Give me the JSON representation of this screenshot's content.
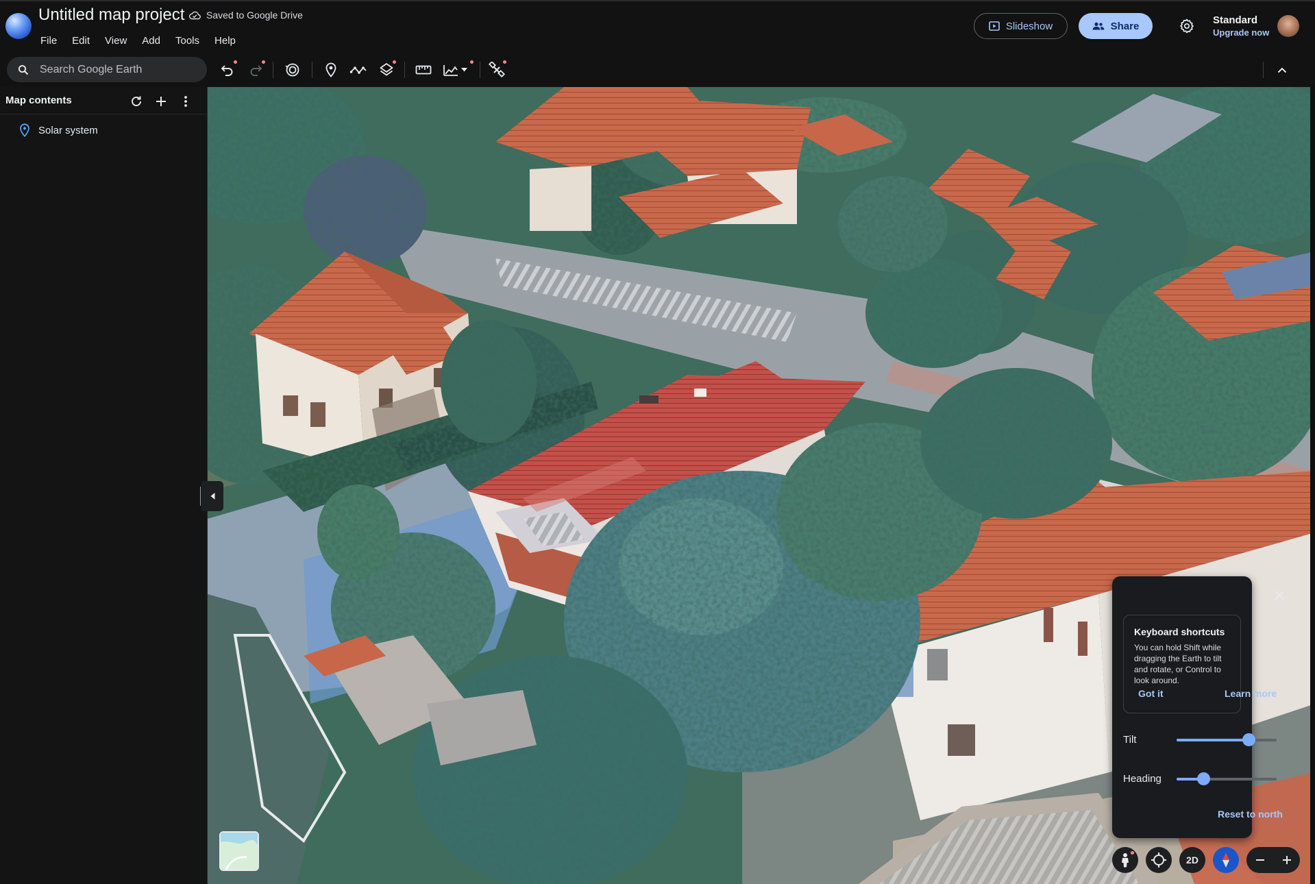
{
  "app": {
    "project_title": "Untitled map project",
    "save_status": "Saved to Google Drive",
    "logo_icon": "google-earth-logo"
  },
  "menu": [
    "File",
    "Edit",
    "View",
    "Add",
    "Tools",
    "Help"
  ],
  "header": {
    "slideshow_label": "Slideshow",
    "share_label": "Share",
    "plan_name": "Standard",
    "upgrade_label": "Upgrade now"
  },
  "search": {
    "placeholder": "Search Google Earth"
  },
  "toolbar_icons": [
    "undo-icon",
    "redo-icon",
    "history-icon",
    "placemark-icon",
    "path-icon",
    "layers-icon",
    "measure-icon",
    "elevation-icon",
    "satellite-icon",
    "collapse-toolbar-icon"
  ],
  "sidebar": {
    "title": "Map contents",
    "items": [
      {
        "label": "Solar system",
        "icon": "placemark-icon"
      }
    ]
  },
  "keyboard_tip": {
    "title": "Keyboard shortcuts",
    "body": "You can hold Shift while dragging the Earth to tilt and rotate, or Control to look around.",
    "got_it": "Got it",
    "learn_more": "Learn more"
  },
  "view_controls": {
    "tilt_label": "Tilt",
    "tilt_value": 0.72,
    "heading_label": "Heading",
    "heading_value": 0.27,
    "reset_label": "Reset to north",
    "mode_label": "2D"
  },
  "colors": {
    "accent": "#a8c7fa",
    "slider": "#7cacf8",
    "background": "#141414",
    "notification_dot": "#f28b82",
    "roof": "#c8664a",
    "tree": "#3b6e5a"
  }
}
